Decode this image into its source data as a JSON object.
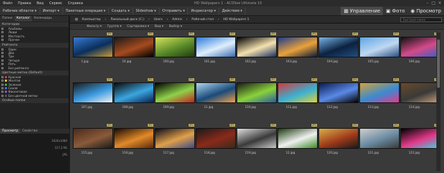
{
  "window": {
    "title": "HD Wallpapers 1 - ACDSee Ultimate 10",
    "menu": [
      "Файл",
      "Правка",
      "Вид",
      "Сервис",
      "Справка"
    ]
  },
  "toolbar": {
    "buttons": [
      "Рабочие области ▾",
      "Импорт ▾",
      "Пакетные операции ▾",
      "Создать ▾",
      "Slideshow ▾",
      "Отправить ▾",
      "Индексатор ▾",
      "Действия ▾"
    ]
  },
  "mode_tabs": {
    "manage": "Управление",
    "photos": "Фото",
    "view": "Просмотр"
  },
  "left_panel": {
    "tabs": [
      "Папки",
      "Каталог",
      "Календарь"
    ],
    "categories_header": "Категории",
    "categories": [
      "Альбомы",
      "Люди",
      "Местность",
      "Прочее"
    ],
    "ratings_header": "Рейтинги",
    "ratings": [
      "Один",
      "Два",
      "Три",
      "Четыре",
      "Пять",
      "Без рейтинга"
    ],
    "color_labels_header": "Цветные метки (Default)",
    "color_labels": [
      "Красная",
      "Желтая",
      "Зеленая",
      "Синяя",
      "Фиолетовая",
      "Без цветной метки"
    ],
    "special_header": "Особые папки",
    "preview_tabs": [
      "Просмотр",
      "Свойства"
    ],
    "preview_values": [
      "1920x1080",
      "117,2 КБ",
      "JPG"
    ]
  },
  "pathbar": {
    "crumbs": [
      "Компьютер",
      "Локальный диск (C:)",
      "Users",
      "Admin",
      "Рабочий стол",
      "HD Wallpapers 1"
    ],
    "search_placeholder": "Быстрый поиск"
  },
  "filterbar": {
    "items": [
      "Фильтр ▾",
      "Группа ▾",
      "Сортировка ▾",
      "Вид ▾",
      "Выбор ▾"
    ]
  },
  "files": [
    {
      "name": "1.jpg",
      "badge": "JPG",
      "colors": [
        "#3a7bd5",
        "#0b2f5a",
        "#c99a3a"
      ]
    },
    {
      "name": "10.jpg",
      "badge": "JPG",
      "colors": [
        "#1a1a1a",
        "#a64b1e",
        "#000"
      ]
    },
    {
      "name": "100.jpg",
      "badge": "JPG",
      "colors": [
        "#d7e35a",
        "#5a8b2a",
        "#1f3a10"
      ]
    },
    {
      "name": "101.jpg",
      "badge": "JPG",
      "colors": [
        "#2b7ad8",
        "#dfeffc",
        "#3a6ab0"
      ]
    },
    {
      "name": "102.jpg",
      "badge": "JPG",
      "colors": [
        "#000",
        "#f5e2b0",
        "#1a3060"
      ]
    },
    {
      "name": "103.jpg",
      "badge": "JPG",
      "colors": [
        "#1c3b8a",
        "#e9a23b",
        "#0a1a3a"
      ]
    },
    {
      "name": "104.jpg",
      "badge": "JPG",
      "colors": [
        "#7ab5e8",
        "#0b2240",
        "#234d80"
      ]
    },
    {
      "name": "105.jpg",
      "badge": "JPG",
      "colors": [
        "#5aa6e6",
        "#c0d8f0",
        "#2a4e80"
      ]
    },
    {
      "name": "106.jpg",
      "badge": "JPG",
      "colors": [
        "#111",
        "#d44a8a",
        "#3a5ec0"
      ]
    },
    {
      "name": "107.jpg",
      "badge": "JPG",
      "colors": [
        "#1a1a1a",
        "#3a9ae0",
        "#f0f0f0"
      ]
    },
    {
      "name": "108.jpg",
      "badge": "JPG",
      "colors": [
        "#0a0a0a",
        "#3aa6e0",
        "#0a2050"
      ]
    },
    {
      "name": "109.jpg",
      "badge": "JPG",
      "colors": [
        "#000",
        "#8ed24a",
        "#c62020"
      ]
    },
    {
      "name": "11.jpg",
      "badge": "JPG",
      "colors": [
        "#b0d6f0",
        "#1a4a7a",
        "#f0a04a"
      ]
    },
    {
      "name": "110.jpg",
      "badge": "JPG",
      "colors": [
        "#1a1a1a",
        "#8ad23a",
        "#2a5aa0"
      ]
    },
    {
      "name": "111.jpg",
      "badge": "JPG",
      "colors": [
        "#d23a3a",
        "#3ab0d2",
        "#e0d23a"
      ]
    },
    {
      "name": "112.jpg",
      "badge": "JPG",
      "colors": [
        "#0a1a50",
        "#5a8ae6",
        "#000"
      ]
    },
    {
      "name": "113.jpg",
      "badge": "JPG",
      "colors": [
        "#d2a23a",
        "#3a8ad2",
        "#e23a8a"
      ]
    },
    {
      "name": "114.jpg",
      "badge": "JPG",
      "colors": [
        "#6a4a2a",
        "#3a3a3a",
        "#c8a07a"
      ]
    },
    {
      "name": "115.jpg",
      "badge": "JPG",
      "colors": [
        "#4a2a1a",
        "#8a5a3a",
        "#1a1a1a"
      ]
    },
    {
      "name": "116.jpg",
      "badge": "JPG",
      "colors": [
        "#1a0a00",
        "#e28a2a",
        "#5a2a0a"
      ]
    },
    {
      "name": "117.jpg",
      "badge": "JPG",
      "colors": [
        "#0a0a1a",
        "#e0a04a",
        "#3a4a8a"
      ]
    },
    {
      "name": "118.jpg",
      "badge": "JPG",
      "colors": [
        "#1a1a1a",
        "#8a2a1a",
        "#3a2a1a"
      ]
    },
    {
      "name": "119.jpg",
      "badge": "JPG",
      "colors": [
        "#e0e0e0",
        "#3a3a3a",
        "#c8c8c8"
      ]
    },
    {
      "name": "12.jpg",
      "badge": "JPG",
      "colors": [
        "#1a3a0a",
        "#f0f0f0",
        "#3a8a2a"
      ]
    },
    {
      "name": "120.jpg",
      "badge": "JPG",
      "colors": [
        "#d8b04a",
        "#a03a1a",
        "#1a1a1a"
      ]
    },
    {
      "name": "121.jpg",
      "badge": "JPG",
      "colors": [
        "#d0d0d0",
        "#6a8aa0",
        "#3a3a3a"
      ]
    },
    {
      "name": "122.jpg",
      "badge": "JPG",
      "colors": [
        "#000",
        "#e23a8a",
        "#3ad2e2"
      ]
    }
  ]
}
